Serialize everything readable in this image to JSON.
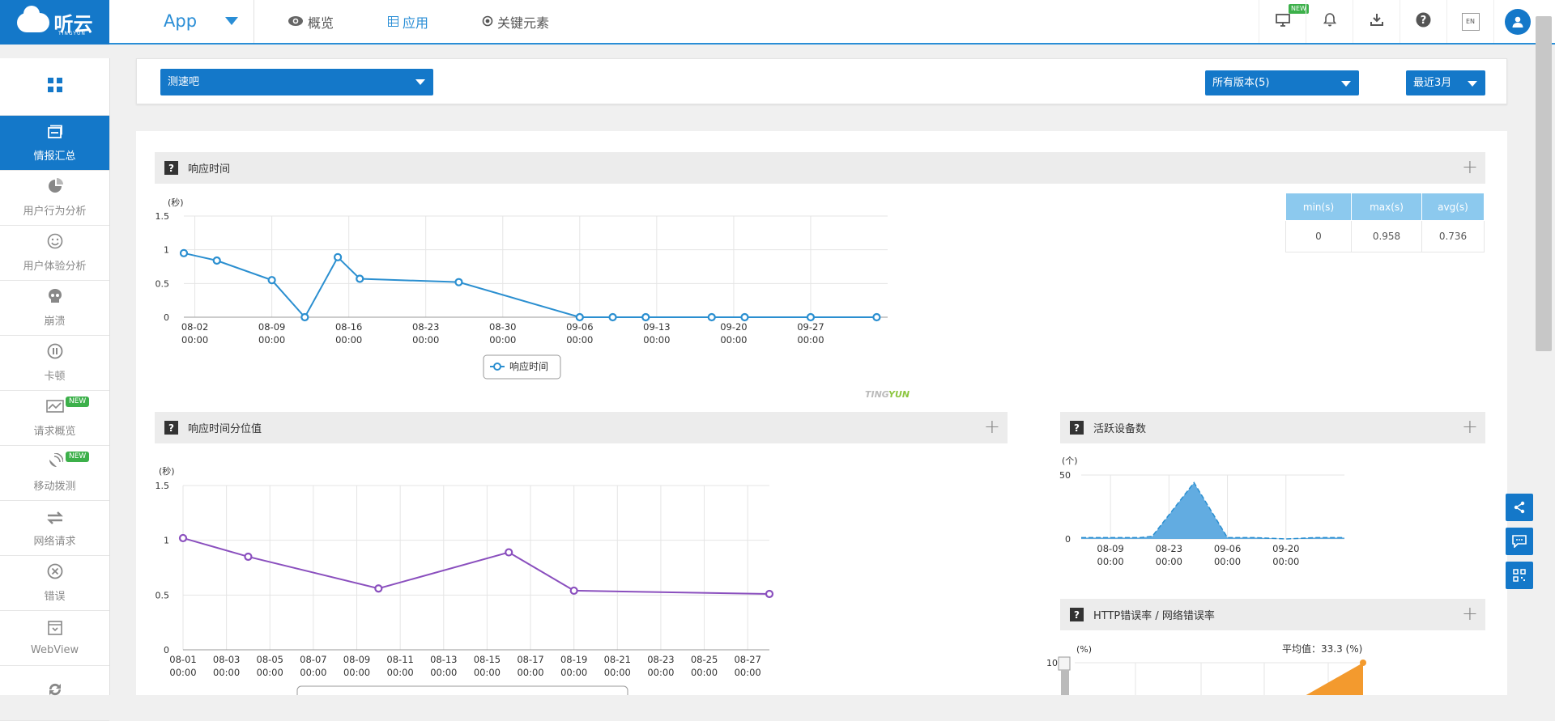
{
  "topbar": {
    "logo_text": "听云",
    "logo_sub": "TINGYUN",
    "app_label": "App",
    "nav": [
      {
        "icon": "eye-icon",
        "label": "概览"
      },
      {
        "icon": "table-icon",
        "label": "应用"
      },
      {
        "icon": "target-icon",
        "label": "关键元素"
      }
    ],
    "new_badge": "NEW",
    "en_label": "EN",
    "icons": [
      "monitor-icon",
      "bell-icon",
      "download-icon",
      "help-icon",
      "language-icon",
      "user-icon"
    ]
  },
  "sidebar": {
    "items": [
      {
        "label": "情报汇总",
        "icon": "dashboard-icon",
        "active": true,
        "new": ""
      },
      {
        "label": "用户行为分析",
        "icon": "pie-chart-icon",
        "new": ""
      },
      {
        "label": "用户体验分析",
        "icon": "smile-icon",
        "new": ""
      },
      {
        "label": "崩溃",
        "icon": "skull-icon",
        "new": ""
      },
      {
        "label": "卡顿",
        "icon": "pause-icon",
        "new": ""
      },
      {
        "label": "请求概览",
        "icon": "request-chart-icon",
        "new": "NEW"
      },
      {
        "label": "移动拨测",
        "icon": "satellite-icon",
        "new": "NEW"
      },
      {
        "label": "网络请求",
        "icon": "exchange-icon",
        "new": ""
      },
      {
        "label": "错误",
        "icon": "error-icon",
        "new": ""
      },
      {
        "label": "WebView",
        "icon": "webview-icon",
        "new": ""
      },
      {
        "label": "",
        "icon": "sync-icon",
        "new": ""
      }
    ]
  },
  "filters": {
    "app": "测速吧",
    "version": "所有版本(5)",
    "range": "最近3月"
  },
  "panels": {
    "response_time": {
      "title": "响应时间",
      "q": "?"
    },
    "percentile": {
      "title": "响应时间分位值",
      "q": "?"
    },
    "active_devices": {
      "title": "活跃设备数",
      "q": "?"
    },
    "http_error": {
      "title": "HTTP错误率 / 网络错误率",
      "q": "?"
    }
  },
  "stats": {
    "headers": [
      "min(s)",
      "max(s)",
      "avg(s)"
    ],
    "values": [
      "0",
      "0.958",
      "0.736"
    ]
  },
  "watermark": {
    "ting": "TING",
    "yun": "YUN"
  },
  "colors": {
    "brand": "#1478c9",
    "accent": "#2a8ed6",
    "series_blue": "#2b8fd0",
    "series_purple": "#8a4fbe",
    "orange": "#f39a2e"
  },
  "chart_data": [
    {
      "type": "line",
      "title": "响应时间",
      "ylabel": "(秒)",
      "ylim": [
        0,
        1.5
      ],
      "yticks": [
        "1.5",
        "1",
        "0.5",
        "0"
      ],
      "xticks": [
        "08-02\n00:00",
        "08-09\n00:00",
        "08-16\n00:00",
        "08-23\n00:00",
        "08-30\n00:00",
        "09-06\n00:00",
        "09-13\n00:00",
        "09-20\n00:00",
        "09-27\n00:00"
      ],
      "xlim": [
        "08-01",
        "10-04"
      ],
      "series": [
        {
          "name": "响应时间",
          "points": [
            [
              "08-01",
              0.95
            ],
            [
              "08-04",
              0.84
            ],
            [
              "08-09",
              0.55
            ],
            [
              "08-12",
              0
            ],
            [
              "08-15",
              0.89
            ],
            [
              "08-17",
              0.57
            ],
            [
              "08-26",
              0.52
            ],
            [
              "09-06",
              0
            ],
            [
              "09-09",
              0
            ],
            [
              "09-12",
              0
            ],
            [
              "09-18",
              0
            ],
            [
              "09-21",
              0
            ],
            [
              "09-27",
              0
            ],
            [
              "10-03",
              0
            ]
          ]
        }
      ],
      "legend": "bottom-center"
    },
    {
      "type": "line",
      "title": "响应时间分位值",
      "ylabel": "(秒)",
      "ylim": [
        0,
        1.5
      ],
      "yticks": [
        "1.5",
        "1",
        "0.5",
        "0"
      ],
      "xticks": [
        "08-01\n00:00",
        "08-03\n00:00",
        "08-05\n00:00",
        "08-07\n00:00",
        "08-09\n00:00",
        "08-11\n00:00",
        "08-13\n00:00",
        "08-15\n00:00",
        "08-17\n00:00",
        "08-19\n00:00",
        "08-21\n00:00",
        "08-23\n00:00",
        "08-25\n00:00",
        "08-27\n00:00"
      ],
      "series": [
        {
          "points": [
            [
              "08-01",
              1.02
            ],
            [
              "08-04",
              0.85
            ],
            [
              "08-10",
              0.56
            ],
            [
              "08-16",
              0.89
            ],
            [
              "08-19",
              0.54
            ],
            [
              "08-28",
              0.51
            ]
          ]
        }
      ],
      "legend": "bottom-center"
    },
    {
      "type": "area",
      "title": "活跃设备数",
      "ylabel": "(个)",
      "ylim": [
        0,
        50
      ],
      "yticks": [
        "50",
        "0"
      ],
      "xticks": [
        "08-09\n00:00",
        "08-23\n00:00",
        "09-06\n00:00",
        "09-20\n00:00"
      ],
      "series": [
        {
          "points": [
            [
              "08-02",
              1
            ],
            [
              "08-09",
              1
            ],
            [
              "08-16",
              1
            ],
            [
              "08-19",
              2
            ],
            [
              "08-29",
              44
            ],
            [
              "09-06",
              1
            ],
            [
              "09-13",
              1
            ],
            [
              "09-20",
              0
            ],
            [
              "09-27",
              1
            ],
            [
              "10-04",
              1
            ]
          ]
        }
      ]
    },
    {
      "type": "area",
      "title": "HTTP错误率 / 网络错误率",
      "ylabel": "(%)",
      "yticks": [
        "100"
      ],
      "annotation": "平均值：33.3 (%)",
      "series": [
        {
          "points": [
            [
              0.6,
              0
            ],
            [
              1.0,
              100
            ]
          ]
        }
      ]
    }
  ]
}
